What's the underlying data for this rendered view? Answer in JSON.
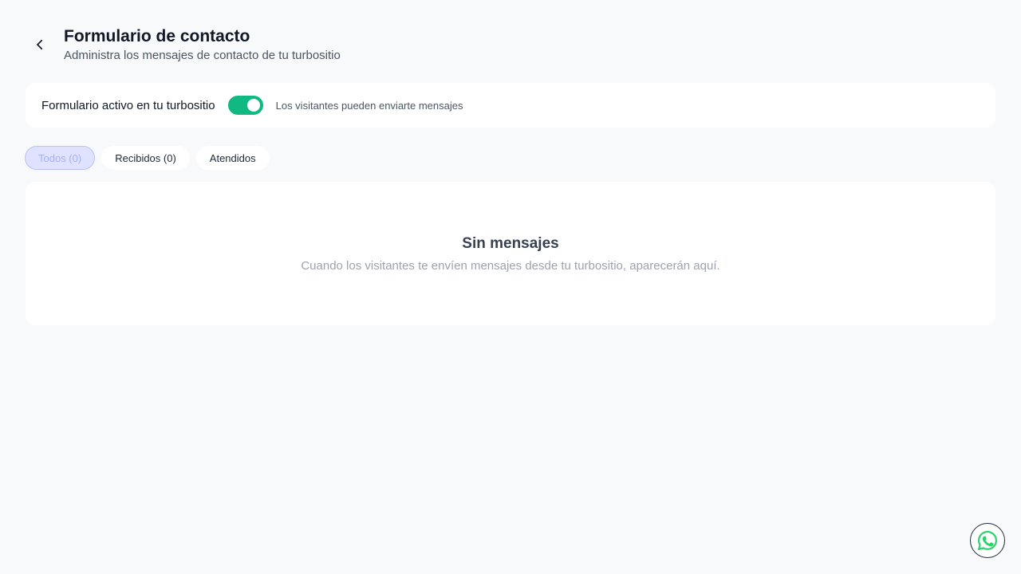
{
  "header": {
    "title": "Formulario de contacto",
    "subtitle": "Administra los mensajes de contacto de tu turbositio"
  },
  "form_toggle": {
    "label": "Formulario activo en tu turbositio",
    "enabled": true,
    "hint": "Los visitantes pueden enviarte mensajes",
    "color": "#10b981"
  },
  "tabs": [
    {
      "label": "Todos (0)",
      "active": true
    },
    {
      "label": "Recibidos (0)",
      "active": false
    },
    {
      "label": "Atendidos",
      "active": false
    }
  ],
  "empty_state": {
    "title": "Sin mensajes",
    "text": "Cuando los visitantes te envíen mensajes desde tu turbositio, aparecerán aquí."
  },
  "floating": {
    "icon": "whatsapp-icon",
    "color": "#25d366"
  }
}
